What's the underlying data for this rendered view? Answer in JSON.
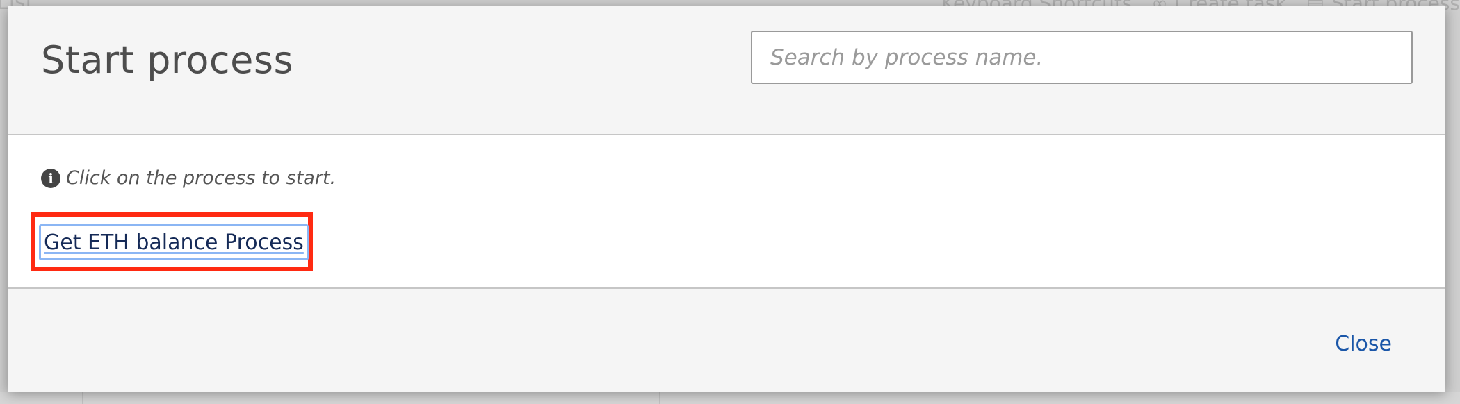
{
  "background": {
    "title_fragment": "List",
    "actions": [
      {
        "icon": "keyboard-icon",
        "label": "Keyboard Shortcuts"
      },
      {
        "icon": "link-icon",
        "label": "Create task"
      },
      {
        "icon": "calendar-icon",
        "label": "Start process"
      }
    ]
  },
  "modal": {
    "title": "Start process",
    "search": {
      "placeholder": "Search by process name.",
      "value": ""
    },
    "hint": {
      "icon": "info-icon",
      "text": "Click on the process to start."
    },
    "processes": [
      {
        "label": "Get ETH balance Process",
        "highlighted": true
      }
    ],
    "footer": {
      "close_label": "Close"
    }
  },
  "colors": {
    "highlight": "#ff2a12",
    "link": "#1a56a8",
    "focus_ring": "#8bb6f4"
  }
}
